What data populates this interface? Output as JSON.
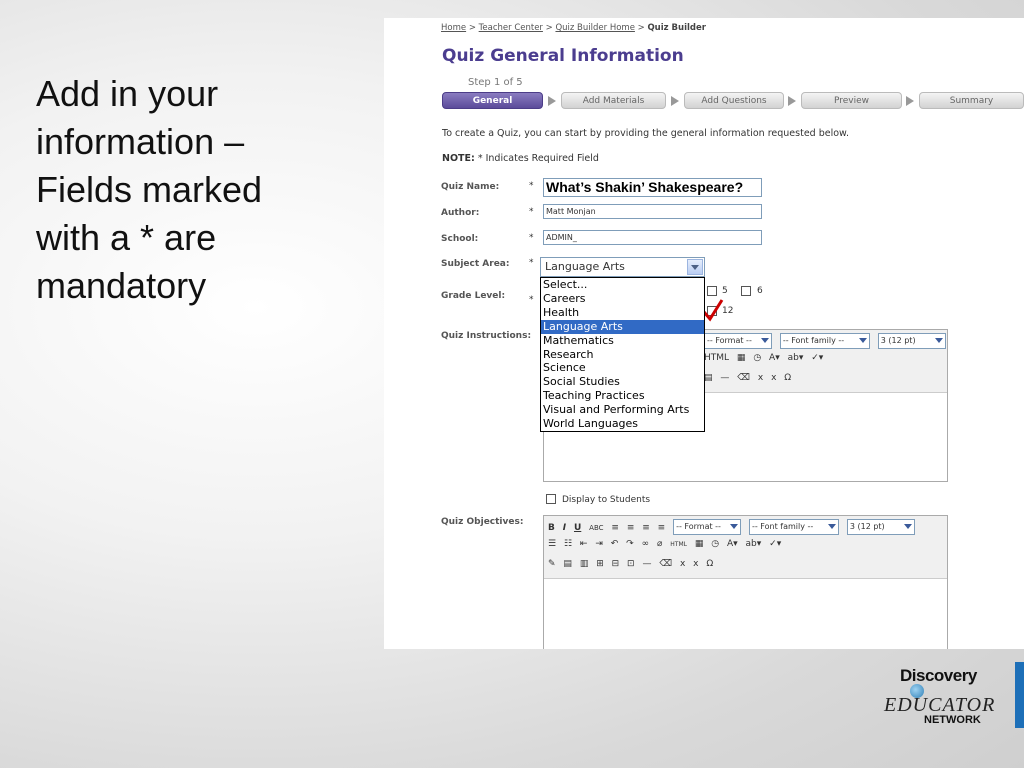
{
  "slide": {
    "text": "Add in your information – Fields marked with a * are mandatory"
  },
  "breadcrumb": {
    "home": "Home",
    "sep1": ">",
    "teacher_center": "Teacher Center",
    "sep2": ">",
    "quiz_builder_home": "Quiz Builder Home",
    "sep3": ">",
    "current": "Quiz Builder"
  },
  "page_title": "Quiz General Information",
  "step_label": "Step 1 of 5",
  "steps": [
    "General Information",
    "Add Materials",
    "Add Questions",
    "Preview",
    "Summary"
  ],
  "intro": "To create a Quiz, you can start by providing the general information requested below.",
  "note": {
    "label": "NOTE:",
    "text": " * Indicates Required Field"
  },
  "required_marker": "*",
  "form": {
    "quiz_name_label": "Quiz Name:",
    "quiz_name_value": "What’s Shakin’ Shakespeare?",
    "author_label": "Author:",
    "author_value": "Matt Monjan",
    "school_label": "School:",
    "school_value": "ADMIN_",
    "subject_label": "Subject Area:",
    "subject_value": "Language Arts",
    "subject_options": [
      "Select...",
      "Careers",
      "Health",
      "Language Arts",
      "Mathematics",
      "Research",
      "Science",
      "Social Studies",
      "Teaching Practices",
      "Visual and Performing Arts",
      "World Languages"
    ],
    "grade_label": "Grade Level:",
    "grade_5": "5",
    "grade_6": "6",
    "grade_12": "12",
    "instructions_label": "Quiz Instructions:",
    "display_to_students": "Display to Students",
    "objectives_label": "Quiz Objectives:"
  },
  "editor_toolbar": {
    "format": "-- Format --",
    "font_family": "-- Font family --",
    "font_size": "3 (12 pt)",
    "bold": "B",
    "italic": "I",
    "underline": "U",
    "strike": "ABC",
    "html": "HTML",
    "omega": "Ω",
    "sub": "x",
    "sup": "x"
  },
  "logo": {
    "line1": "Discovery",
    "line2": "EDUCATOR",
    "line3": "NETWORK"
  },
  "colors": {
    "title": "#4b3d8f",
    "active_step": "#5b4b9a",
    "selected_option": "#316ac5",
    "brand_bar": "#1d6fb8"
  }
}
